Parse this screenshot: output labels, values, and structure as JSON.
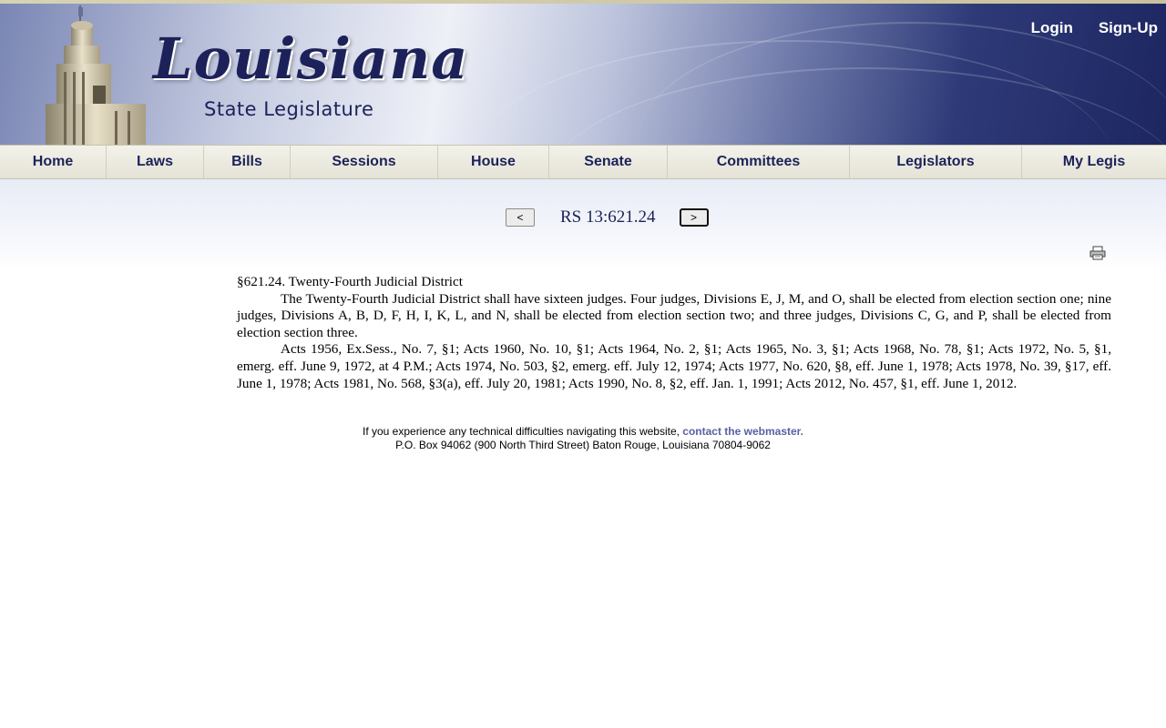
{
  "header": {
    "logo_main": "Louisiana",
    "logo_sub": "State Legislature",
    "login_label": "Login",
    "signup_label": "Sign-Up"
  },
  "nav": {
    "items": [
      {
        "label": "Home"
      },
      {
        "label": "Laws"
      },
      {
        "label": "Bills"
      },
      {
        "label": "Sessions"
      },
      {
        "label": "House"
      },
      {
        "label": "Senate"
      },
      {
        "label": "Committees"
      },
      {
        "label": "Legislators"
      },
      {
        "label": "My Legis"
      }
    ]
  },
  "pager": {
    "prev_label": "<",
    "next_label": ">",
    "title": "RS 13:621.24"
  },
  "print": {
    "icon": "printer-icon"
  },
  "law": {
    "heading": "§621.24.  Twenty-Fourth Judicial District",
    "body": "The Twenty-Fourth Judicial District shall have sixteen judges.  Four judges, Divisions E, J, M, and O, shall be elected from election section one; nine judges, Divisions A, B, D, F, H, I, K, L, and N, shall be elected from election section two; and three judges, Divisions C, G, and P, shall be elected from election section three.",
    "history": "Acts 1956, Ex.Sess., No. 7, §1; Acts 1960, No. 10, §1; Acts 1964, No. 2, §1; Acts 1965, No. 3, §1; Acts 1968, No. 78, §1; Acts 1972, No. 5, §1, emerg. eff. June 9, 1972, at 4 P.M.; Acts 1974, No. 503, §2, emerg. eff. July 12, 1974; Acts 1977, No. 620, §8, eff. June 1, 1978; Acts 1978, No. 39, §17, eff. June 1, 1978; Acts 1981, No. 568, §3(a), eff. July 20, 1981; Acts 1990, No. 8, §2, eff. Jan. 1, 1991; Acts 2012, No. 457, §1, eff. June 1, 2012."
  },
  "footer": {
    "help_text": "If you experience any technical difficulties navigating this website, ",
    "webmaster_link": "contact the webmaster.",
    "address": "P.O. Box 94062 (900 North Third Street) Baton Rouge, Louisiana 70804-9062"
  },
  "colors": {
    "brand_navy": "#1c2259",
    "link_purple": "#5a5fa3"
  }
}
